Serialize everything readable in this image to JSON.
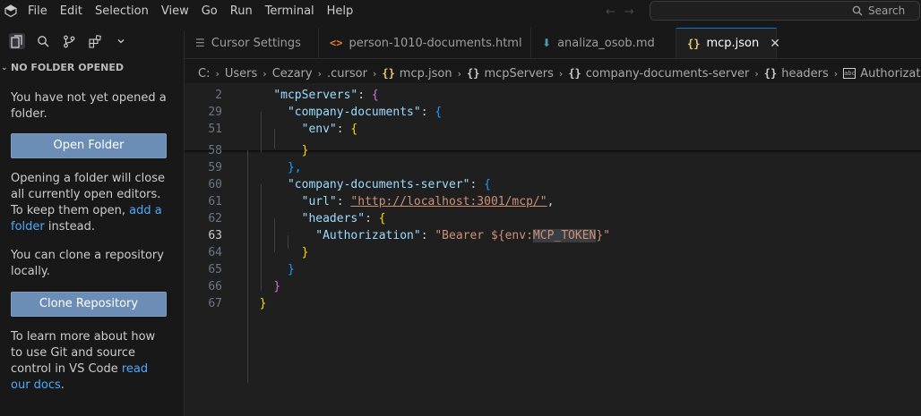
{
  "menu": [
    "File",
    "Edit",
    "Selection",
    "View",
    "Go",
    "Run",
    "Terminal",
    "Help"
  ],
  "search": {
    "label": "Search"
  },
  "sidebar": {
    "header": "NO FOLDER OPENED",
    "msg1": "You have not yet opened a folder.",
    "open_folder": "Open Folder",
    "msg2_pre": "Opening a folder will close all currently open editors. To keep them open, ",
    "msg2_link": "add a folder",
    "msg2_post": " instead.",
    "msg3": "You can clone a repository locally.",
    "clone_repo": "Clone Repository",
    "msg4_pre": "To learn more about how to use Git and source control in VS Code ",
    "msg4_link": "read our docs",
    "msg4_post": "."
  },
  "tabs": [
    {
      "label": "Cursor Settings",
      "icon": "settings-icon"
    },
    {
      "label": "person-1010-documents.html",
      "icon": "html-icon"
    },
    {
      "label": "analiza_osob.md",
      "icon": "markdown-icon"
    },
    {
      "label": "mcp.json",
      "icon": "json-icon",
      "active": true
    }
  ],
  "breadcrumb": [
    "C:",
    "Users",
    "Cezary",
    ".cursor",
    "mcp.json",
    "mcpServers",
    "company-documents-server",
    "headers",
    "Authorization"
  ],
  "editor": {
    "lines": [
      {
        "n": "2",
        "indent": "    ",
        "key": "\"mcpServers\"",
        "rest": ": ",
        "open": "{",
        "ocls": "b1"
      },
      {
        "n": "29",
        "indent": "      ",
        "key": "\"company-documents\"",
        "rest": ": ",
        "open": "{",
        "ocls": "b2"
      },
      {
        "n": "51",
        "indent": "        ",
        "key": "\"env\"",
        "rest": ": ",
        "open": "{",
        "ocls": "b3"
      },
      {
        "n": "58",
        "indent": "        ",
        "close": "}",
        "ccls": "b3"
      },
      {
        "n": "59",
        "indent": "      ",
        "close": "},",
        "ccls": "b2"
      },
      {
        "n": "60",
        "indent": "      ",
        "key": "\"company-documents-server\"",
        "rest": ": ",
        "open": "{",
        "ocls": "b2"
      },
      {
        "n": "61",
        "indent": "        ",
        "key": "\"url\"",
        "rest": ": ",
        "url": "\"http://localhost:3001/mcp/\"",
        "tail": ","
      },
      {
        "n": "62",
        "indent": "        ",
        "key": "\"headers\"",
        "rest": ": ",
        "open": "{",
        "ocls": "b3"
      },
      {
        "n": "63",
        "indent": "          ",
        "key": "\"Authorization\"",
        "rest": ": ",
        "s1": "\"Bearer ${env:",
        "shl": "MCP_TOKEN",
        "s2": "}\"",
        "current": true
      },
      {
        "n": "64",
        "indent": "        ",
        "close": "}",
        "ccls": "b3"
      },
      {
        "n": "65",
        "indent": "      ",
        "close": "}",
        "ccls": "b2"
      },
      {
        "n": "66",
        "indent": "    ",
        "close": "}",
        "ccls": "b1"
      },
      {
        "n": "67",
        "indent": "  ",
        "close": "}",
        "ccls": "b3"
      }
    ]
  },
  "colors": {
    "accent": "#0078d4",
    "button": "#6c8db5",
    "link": "#4daafc"
  }
}
